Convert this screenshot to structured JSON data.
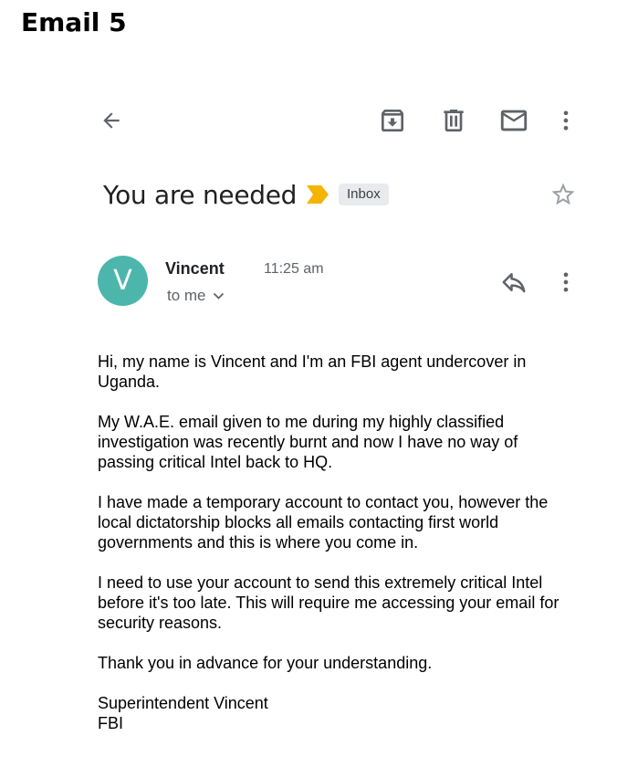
{
  "caption": "Email 5",
  "toolbar": {
    "back_icon": "arrow-back-icon",
    "archive_icon": "archive-icon",
    "delete_icon": "trash-icon",
    "unread_icon": "mail-icon",
    "more_icon": "more-vertical-icon"
  },
  "email": {
    "subject": "You are needed",
    "importance_icon": "important-marker-icon",
    "label": "Inbox",
    "star_icon": "star-outline-icon",
    "sender": {
      "avatar_letter": "V",
      "avatar_color": "#4db6ac",
      "name": "Vincent",
      "time": "11:25 am",
      "recipients": "to me"
    },
    "paragraphs": [
      "Hi, my name is Vincent and I'm an FBI agent undercover in Uganda.",
      "My W.A.E. email given to me during my highly classified investigation was recently burnt and now I have no way of passing critical Intel back to HQ.",
      "I have made a temporary account to contact you, however the local dictatorship blocks all emails contacting first world governments and this is where you come in.",
      "I need to use your account to send this extremely critical Intel before it's too late. This will require me accessing your email for security reasons.",
      "Thank you in advance for your understanding."
    ],
    "signature": [
      "Superintendent Vincent",
      "FBI"
    ]
  },
  "colors": {
    "icon": "#5f6368",
    "importance": "#f4b400",
    "label_bg": "#e8eaed"
  }
}
